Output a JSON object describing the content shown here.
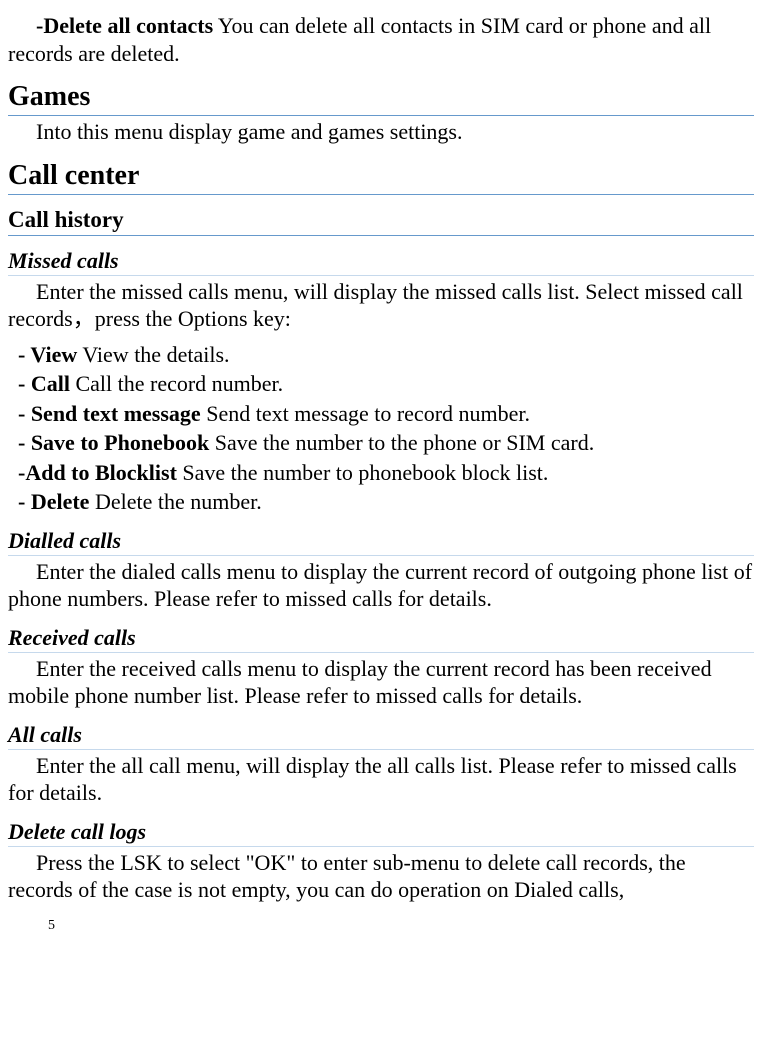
{
  "intro": {
    "delete_all_label": "-Delete all contacts",
    "delete_all_desc": "    You can delete all contacts in SIM card or phone and all records are deleted."
  },
  "games": {
    "heading": "Games",
    "body": "Into this menu display game and games settings."
  },
  "call_center": {
    "heading": "Call center",
    "call_history": {
      "heading": "Call history",
      "missed": {
        "heading": "Missed calls",
        "intro": "Enter the missed calls menu, will display the missed calls list. Select missed call records，press the Options key:",
        "options": [
          {
            "label": "- View",
            "desc": "       View the details."
          },
          {
            "label": "- Call",
            "desc": "       Call the record number."
          },
          {
            "label": "- Send text message",
            "desc": "     Send text message to record number."
          },
          {
            "label": "- Save to Phonebook",
            "desc": "       Save the number to the phone or SIM card."
          },
          {
            "label": "-Add to Blocklist",
            "desc": "     Save the number to phonebook block list."
          },
          {
            "label": "- Delete",
            "desc": "        Delete the number."
          }
        ]
      },
      "dialled": {
        "heading": "Dialled calls",
        "body": "Enter the dialed calls menu to display the current record of outgoing phone list of phone numbers. Please refer to missed calls for details."
      },
      "received": {
        "heading": "Received calls",
        "body": "Enter the received calls menu to display the current record has been received mobile phone number list. Please refer to missed calls for details."
      },
      "all": {
        "heading": "All calls",
        "body": "Enter the all call menu, will display the all calls list. Please refer to missed calls for details."
      },
      "delete_logs": {
        "heading": "Delete call logs",
        "body": "Press the LSK to select \"OK\" to enter sub-menu to delete call records, the records of the case is not empty, you can do operation on Dialed calls,"
      }
    }
  },
  "page_number": "5"
}
